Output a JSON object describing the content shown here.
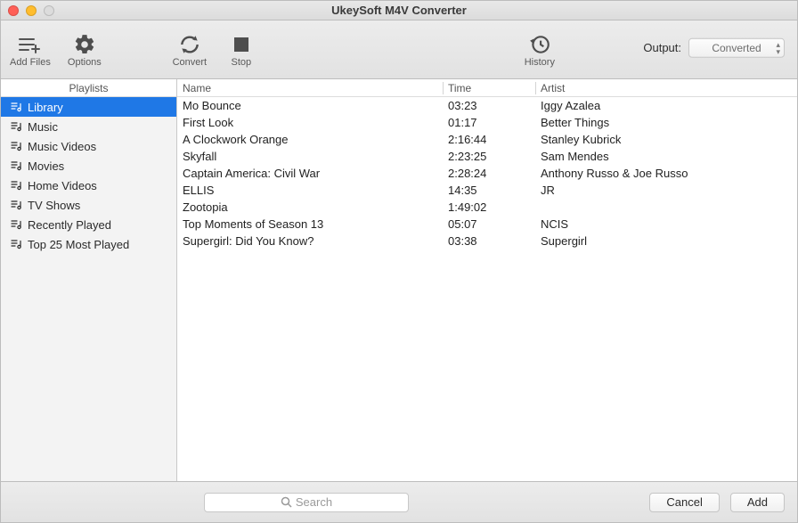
{
  "window": {
    "title": "UkeySoft M4V Converter"
  },
  "toolbar": {
    "add_files": "Add Files",
    "options": "Options",
    "convert": "Convert",
    "stop": "Stop",
    "history": "History",
    "output_label": "Output:",
    "output_value": "Converted"
  },
  "sidebar": {
    "header": "Playlists",
    "items": [
      {
        "label": "Library",
        "selected": true
      },
      {
        "label": "Music",
        "selected": false
      },
      {
        "label": "Music Videos",
        "selected": false
      },
      {
        "label": "Movies",
        "selected": false
      },
      {
        "label": "Home Videos",
        "selected": false
      },
      {
        "label": "TV Shows",
        "selected": false
      },
      {
        "label": "Recently Played",
        "selected": false
      },
      {
        "label": "Top 25 Most Played",
        "selected": false
      }
    ]
  },
  "table": {
    "columns": {
      "name": "Name",
      "time": "Time",
      "artist": "Artist"
    },
    "rows": [
      {
        "name": "Mo Bounce",
        "time": "03:23",
        "artist": "Iggy Azalea"
      },
      {
        "name": "First Look",
        "time": "01:17",
        "artist": "Better Things"
      },
      {
        "name": "A Clockwork Orange",
        "time": "2:16:44",
        "artist": "Stanley Kubrick"
      },
      {
        "name": "Skyfall",
        "time": "2:23:25",
        "artist": "Sam Mendes"
      },
      {
        "name": "Captain America: Civil War",
        "time": "2:28:24",
        "artist": "Anthony Russo & Joe Russo"
      },
      {
        "name": "ELLIS",
        "time": "14:35",
        "artist": "JR"
      },
      {
        "name": "Zootopia",
        "time": "1:49:02",
        "artist": ""
      },
      {
        "name": "Top Moments of Season 13",
        "time": "05:07",
        "artist": "NCIS"
      },
      {
        "name": "Supergirl: Did You Know?",
        "time": "03:38",
        "artist": "Supergirl"
      }
    ]
  },
  "footer": {
    "search_placeholder": "Search",
    "cancel": "Cancel",
    "add": "Add"
  }
}
